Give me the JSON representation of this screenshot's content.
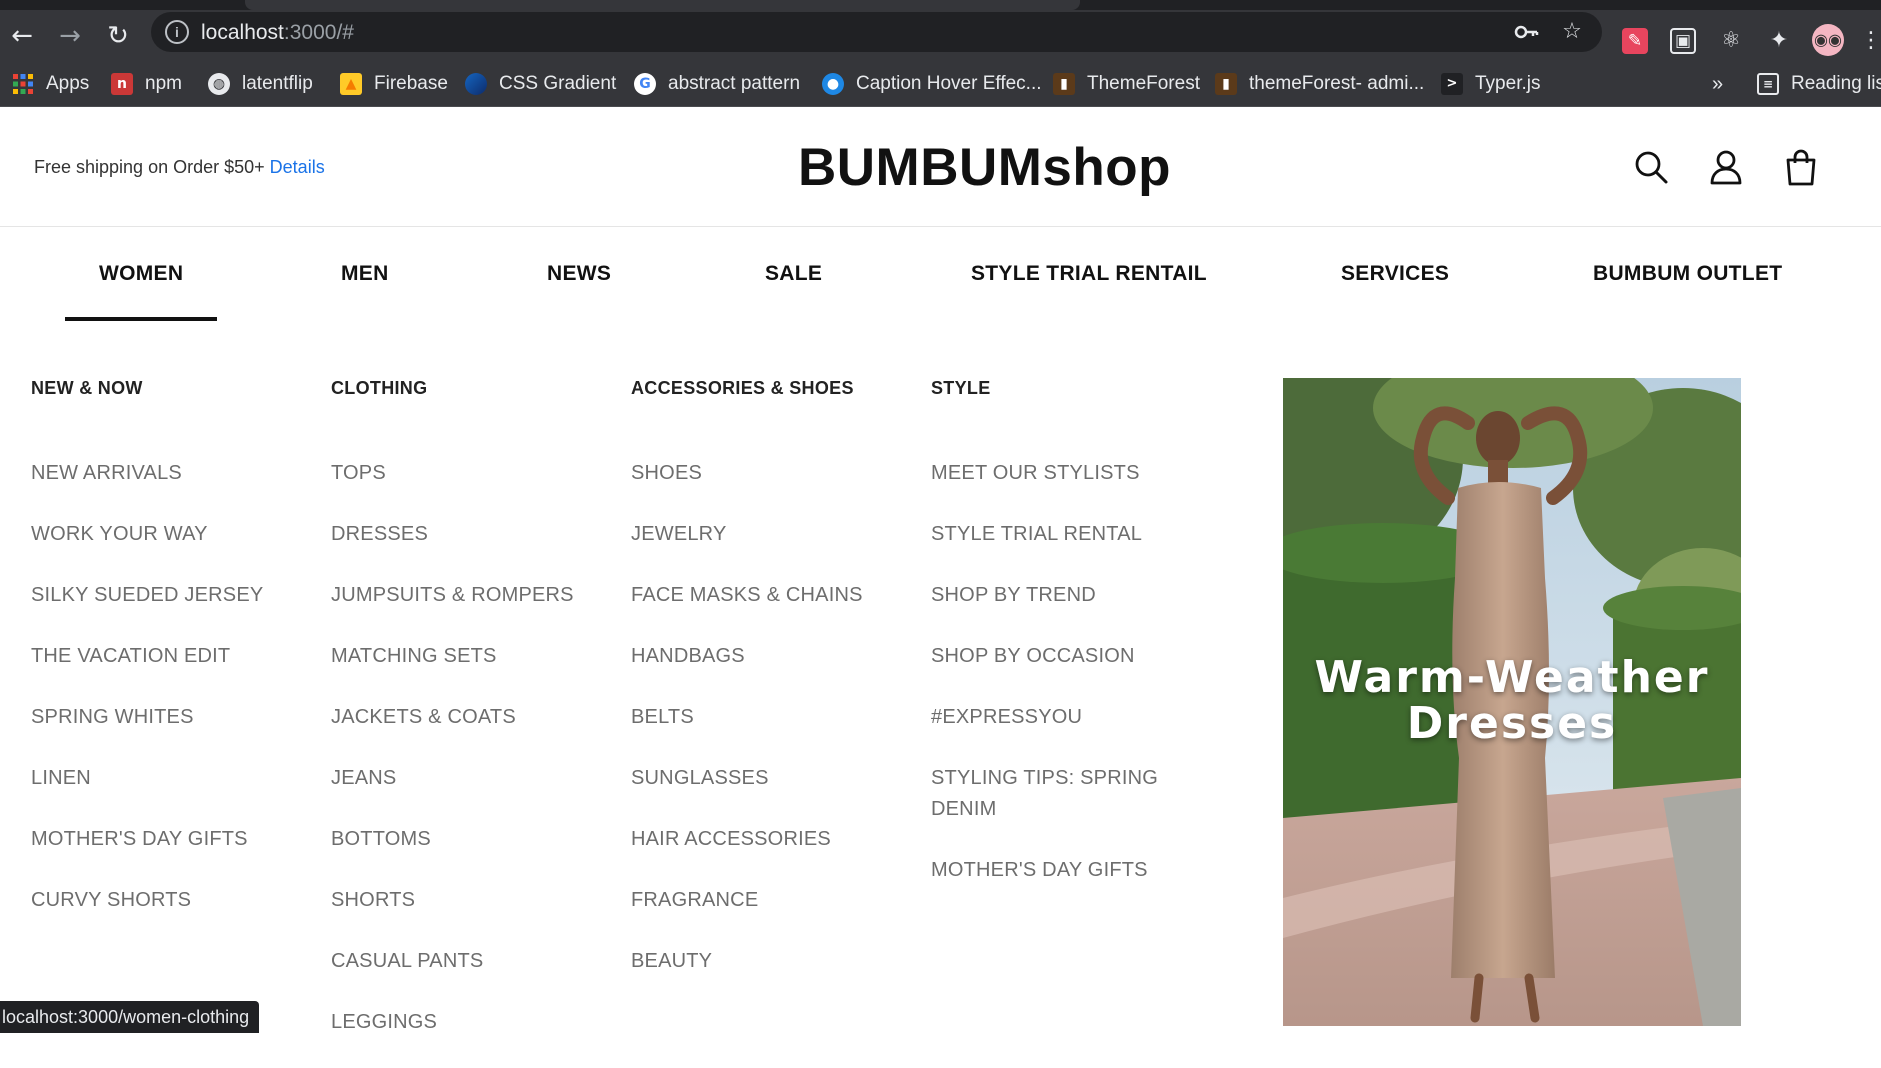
{
  "browser": {
    "url_host": "localhost",
    "url_path": ":3000/#",
    "bookmarks": [
      "Apps",
      "npm",
      "latentflip",
      "Firebase",
      "CSS Gradient",
      "abstract pattern",
      "Caption Hover Effec...",
      "ThemeForest",
      "themeForest- admi...",
      "Typer.js"
    ],
    "more_bookmarks": "»",
    "reading_list": "Reading list",
    "status_url": "localhost:3000/women-clothing"
  },
  "header": {
    "shipping_text": "Free shipping on Order $50+",
    "shipping_link": "Details",
    "logo": "BUMBUMshop"
  },
  "nav": {
    "items": [
      "WOMEN",
      "MEN",
      "NEWS",
      "SALE",
      "STYLE TRIAL RENTAIL",
      "SERVICES",
      "BUMBUM OUTLET"
    ],
    "active": "WOMEN"
  },
  "menu": {
    "columns": [
      {
        "title": "NEW & NOW",
        "items": [
          "NEW ARRIVALS",
          "WORK YOUR WAY",
          "SILKY SUEDED JERSEY",
          "THE VACATION EDIT",
          "SPRING WHITES",
          "LINEN",
          "MOTHER'S DAY GIFTS",
          "CURVY SHORTS"
        ]
      },
      {
        "title": "CLOTHING",
        "items": [
          "TOPS",
          "DRESSES",
          "JUMPSUITS & ROMPERS",
          "MATCHING SETS",
          "JACKETS & COATS",
          "JEANS",
          "BOTTOMS",
          "SHORTS",
          "CASUAL PANTS",
          "LEGGINGS"
        ]
      },
      {
        "title": "ACCESSORIES & SHOES",
        "items": [
          "SHOES",
          "JEWELRY",
          "FACE MASKS & CHAINS",
          "HANDBAGS",
          "BELTS",
          "SUNGLASSES",
          "HAIR ACCESSORIES",
          "FRAGRANCE",
          "BEAUTY"
        ]
      },
      {
        "title": "STYLE",
        "items": [
          "MEET OUR STYLISTS",
          "STYLE TRIAL RENTAL",
          "SHOP BY TREND",
          "SHOP BY OCCASION",
          "#EXPRESSYOU",
          "STYLING TIPS: SPRING DENIM",
          "MOTHER'S DAY GIFTS"
        ]
      }
    ],
    "promo": {
      "line1": "Warm-Weather",
      "line2": "Dresses"
    }
  }
}
